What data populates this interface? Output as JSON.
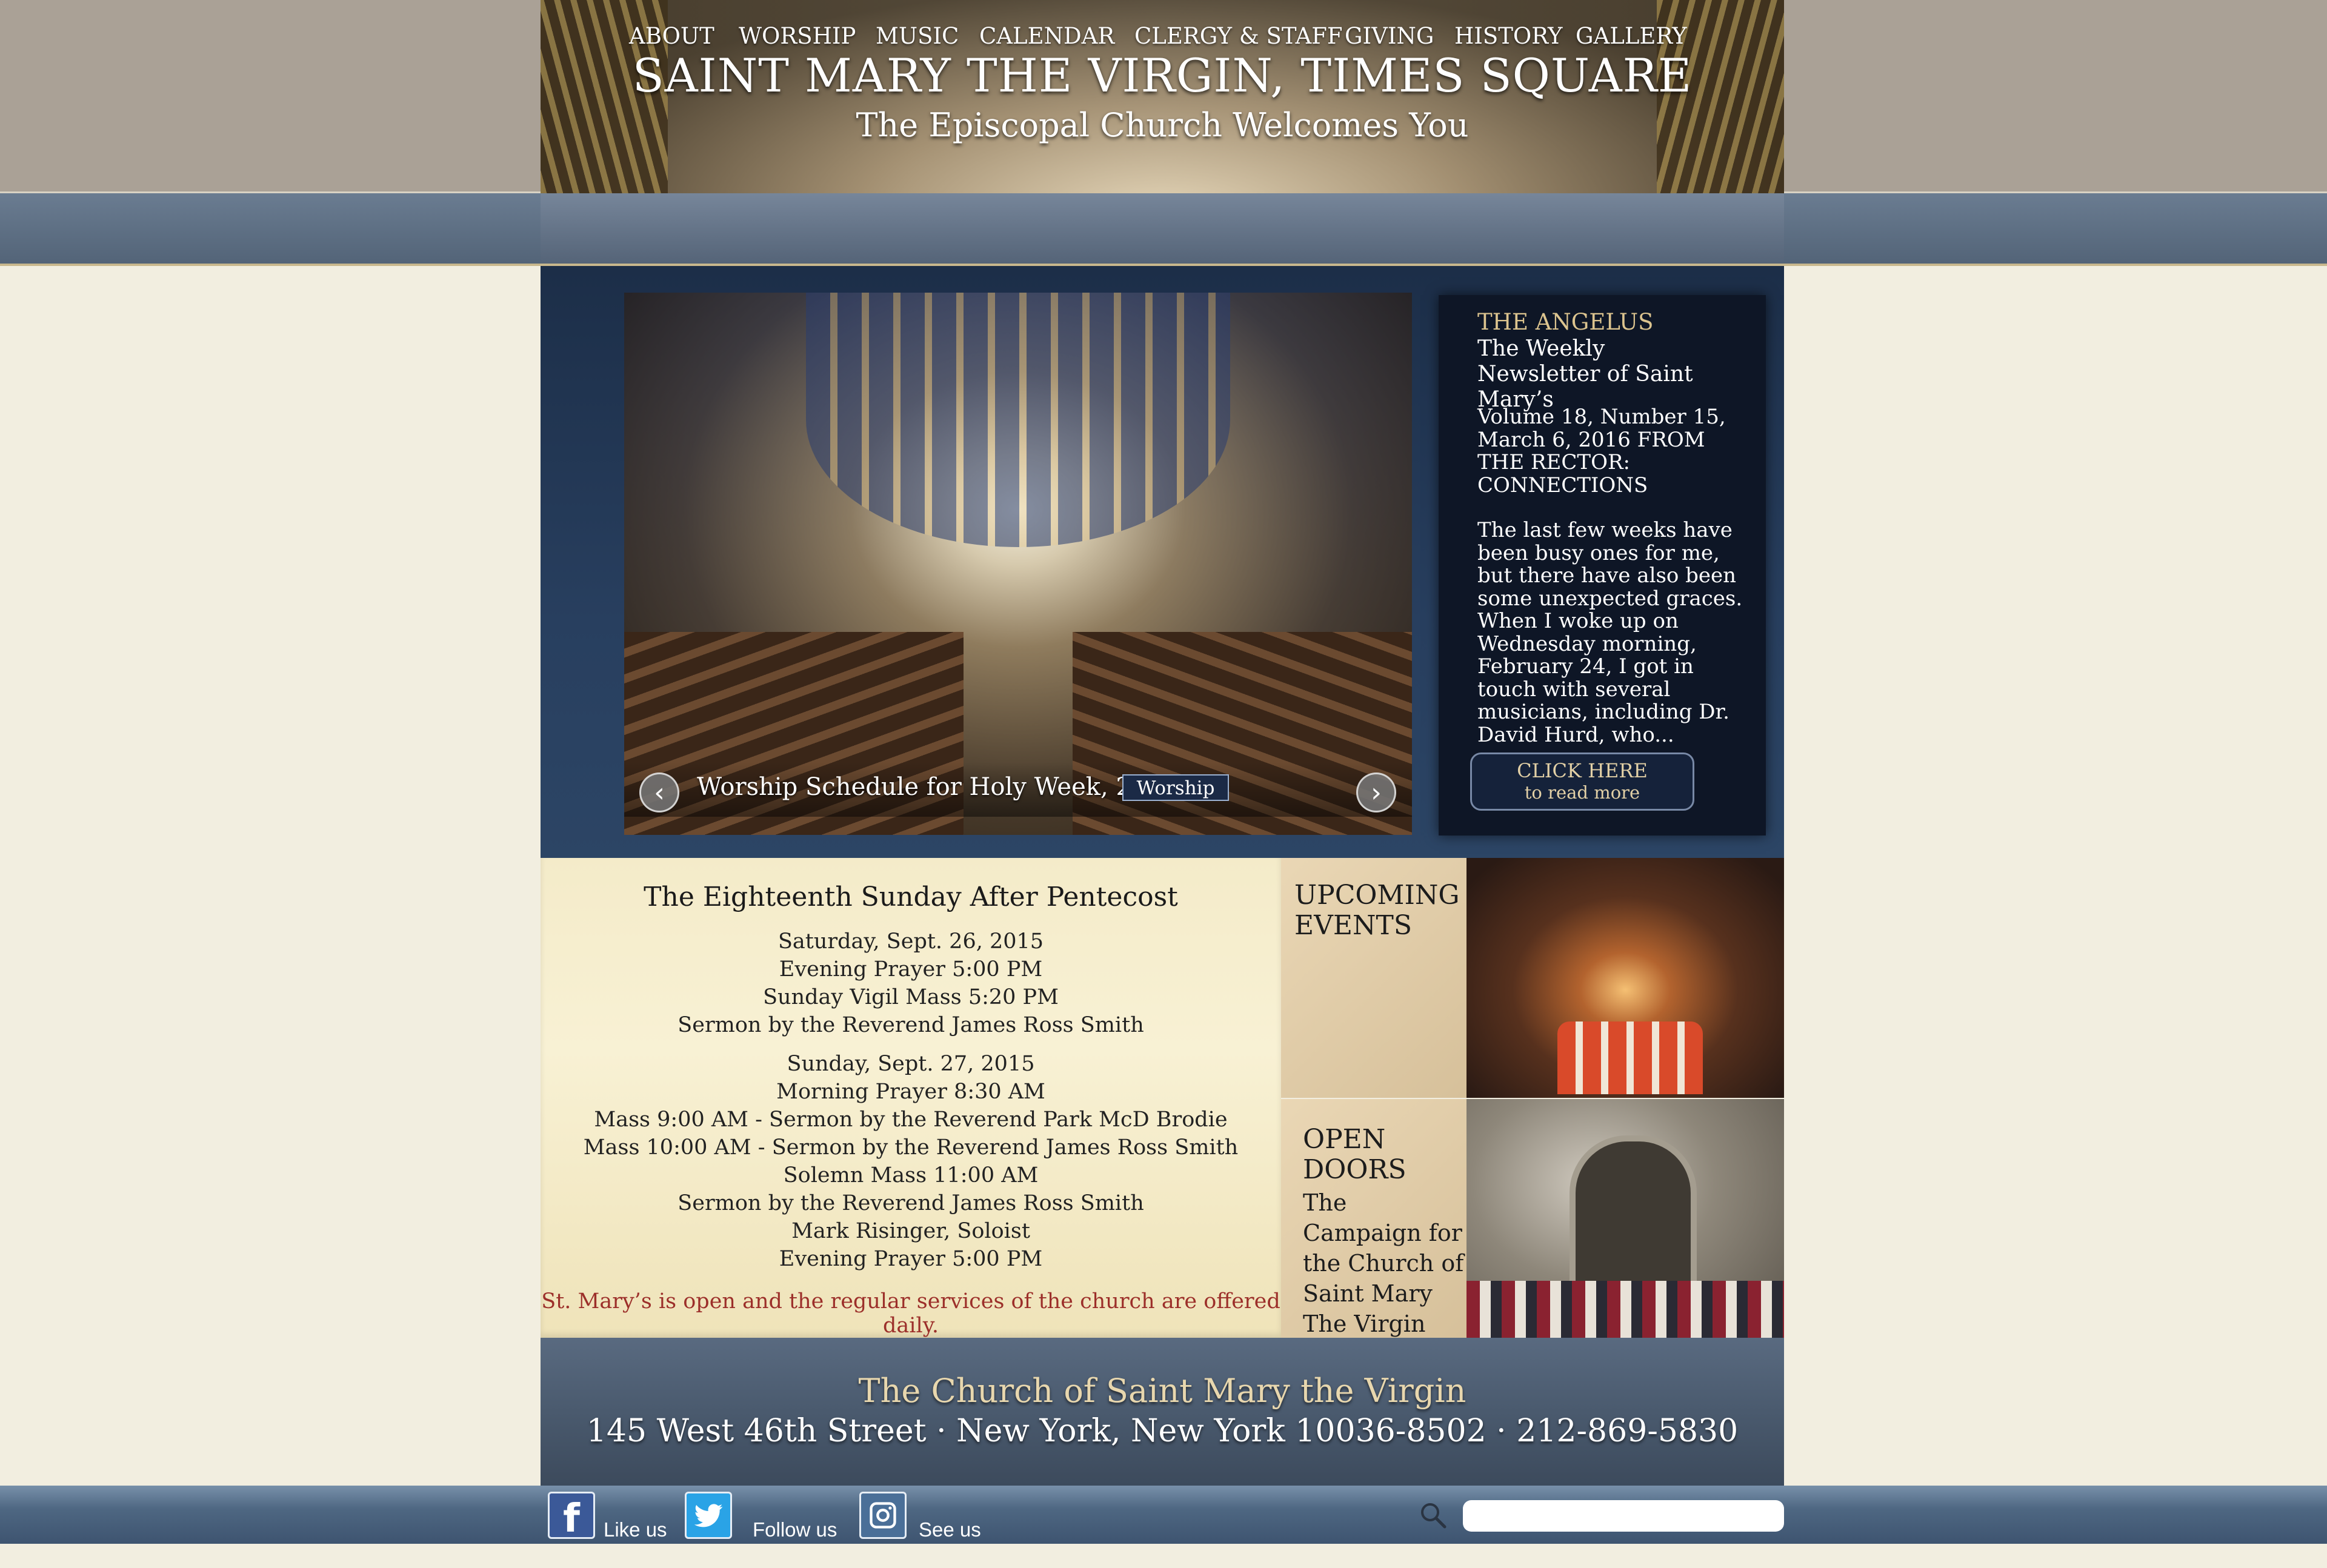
{
  "header": {
    "title": "SAINT MARY THE VIRGIN, TIMES SQUARE",
    "subtitle": "The Episcopal Church Welcomes You"
  },
  "nav": {
    "items": [
      "ABOUT",
      "WORSHIP",
      "MUSIC",
      "CALENDAR",
      "CLERGY & STAFF",
      "GIVING",
      "HISTORY",
      "GALLERY"
    ]
  },
  "slider": {
    "caption": "Worship Schedule for Holy Week, 2016",
    "tag": "Worship",
    "prev_icon": "chevron-left-icon",
    "next_icon": "chevron-right-icon"
  },
  "angelus": {
    "title": "THE ANGELUS",
    "subtitle": "The Weekly Newsletter of Saint Mary’s",
    "issue": "Volume 18, Number 15, March 6, 2016 FROM THE RECTOR: CONNECTIONS",
    "excerpt": "The last few weeks have been busy ones for me, but there have also been some unexpected graces. When I woke up on Wednesday morning, February 24, I got in touch with several musicians, including Dr. David Hurd, who...",
    "button_line1": "CLICK HERE",
    "button_line2": "to read more"
  },
  "schedule": {
    "title": "The Eighteenth Sunday After Pentecost",
    "lines": [
      "Saturday, Sept. 26, 2015",
      "Evening Prayer 5:00 PM",
      "Sunday Vigil Mass 5:20 PM",
      "Sermon by the Reverend James Ross Smith",
      "Sunday, Sept. 27, 2015",
      "Morning Prayer 8:30 AM",
      "Mass 9:00 AM - Sermon by the Reverend Park McD Brodie",
      "Mass 10:00 AM - Sermon by the Reverend James Ross Smith",
      "Solemn Mass 11:00 AM",
      "Sermon by the Reverend James Ross Smith",
      "Mark Risinger, Soloist",
      "Evening Prayer 5:00 PM"
    ],
    "note": "St. Mary’s is open and the regular services of the church are offered daily."
  },
  "tiles": {
    "events_heading": "UPCOMING EVENTS",
    "doors_heading": "OPEN DOORS",
    "doors_caption": "The Campaign for the Church of Saint Mary The Virgin"
  },
  "footer": {
    "name": "The Church of Saint Mary the Virgin",
    "address": "145 West 46th Street ·  New York, New York 10036-8502 · 212-869-5830"
  },
  "social": {
    "facebook_label": "Like us",
    "twitter_label": "Follow us",
    "instagram_label": "See us",
    "search_placeholder": ""
  },
  "colors": {
    "nav_blue": "#5a6b80",
    "gold": "#dcc48f",
    "note_red": "#9c2f2a",
    "cream": "#f2eee0"
  }
}
